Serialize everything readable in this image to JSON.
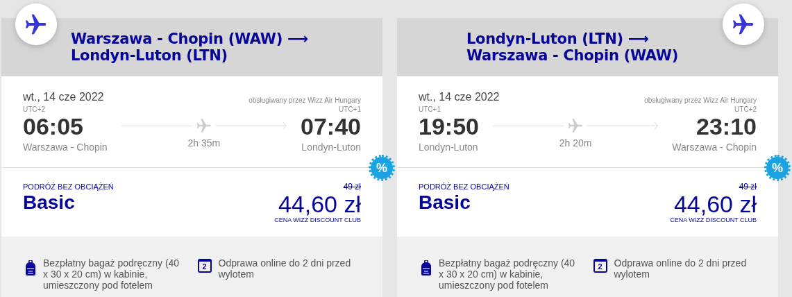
{
  "flights": [
    {
      "title": "Warszawa - Chopin (WAW) ⟶ Londyn-Luton (LTN)",
      "date": "wt., 14 cze 2022",
      "operator": "obsługiwany przez Wizz Air Hungary",
      "departure": {
        "utc": "UTC+2",
        "time": "06:05",
        "airport": "Warszawa - Chopin"
      },
      "duration": "2h 35m",
      "arrival": {
        "utc": "UTC+1",
        "time": "07:40",
        "airport": "Londyn-Luton"
      },
      "discount_badge": "%",
      "fare": {
        "label": "PODRÓŻ BEZ OBCIĄŻEŃ",
        "name": "Basic",
        "old_price": "49 zł",
        "price": "44,60 zł",
        "price_note": "CENA WIZZ DISCOUNT CLUB"
      },
      "features": [
        {
          "kind": "bag",
          "text": "Bezpłatny bagaż podręczny (40 x 30 x 20 cm) w kabinie, umieszczony pod fotelem"
        },
        {
          "kind": "checkin",
          "icon_text": "2",
          "text": "Odprawa online do 2 dni przed wylotem"
        }
      ]
    },
    {
      "title": "Londyn-Luton (LTN) ⟶ Warszawa - Chopin (WAW)",
      "date": "wt., 14 cze 2022",
      "operator": "obsługiwany przez Wizz Air Hungary",
      "departure": {
        "utc": "UTC+1",
        "time": "19:50",
        "airport": "Londyn-Luton"
      },
      "duration": "2h 20m",
      "arrival": {
        "utc": "UTC+2",
        "time": "23:10",
        "airport": "Warszawa - Chopin"
      },
      "discount_badge": "%",
      "fare": {
        "label": "PODRÓŻ BEZ OBCIĄŻEŃ",
        "name": "Basic",
        "old_price": "49 zł",
        "price": "44,60 zł",
        "price_note": "CENA WIZZ DISCOUNT CLUB"
      },
      "features": [
        {
          "kind": "bag",
          "text": "Bezpłatny bagaż podręczny (40 x 30 x 20 cm) w kabinie, umieszczony pod fotelem"
        },
        {
          "kind": "checkin",
          "icon_text": "2",
          "text": "Odprawa online do 2 dni przed wylotem"
        }
      ]
    }
  ]
}
